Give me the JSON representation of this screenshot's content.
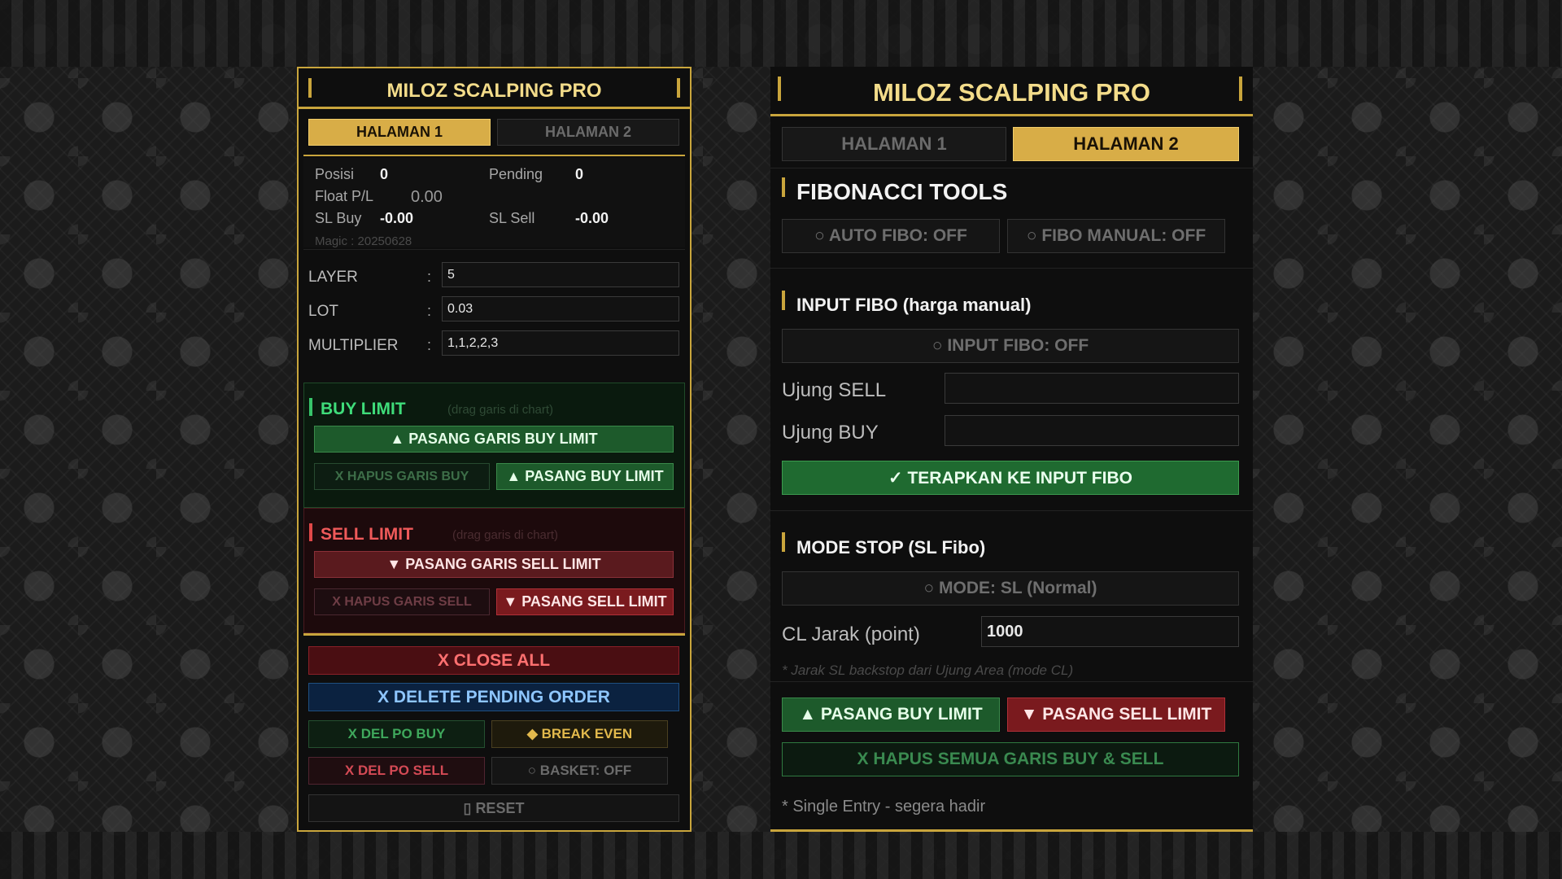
{
  "app_title": "MILOZ SCALPING PRO",
  "tabs": {
    "page1": "HALAMAN 1",
    "page2": "HALAMAN 2"
  },
  "page1": {
    "stats": {
      "posisi_label": "Posisi",
      "posisi_value": "0",
      "pending_label": "Pending",
      "pending_value": "0",
      "float_label": "Float P/L",
      "float_value": "0.00",
      "slbuy_label": "SL Buy",
      "slbuy_value": "-0.00",
      "slsell_label": "SL Sell",
      "slsell_value": "-0.00",
      "magic": "Magic : 20250628"
    },
    "params": [
      {
        "label": "LAYER",
        "value": "5"
      },
      {
        "label": "LOT",
        "value": "0.03"
      },
      {
        "label": "MULTIPLIER",
        "value": "1,1,2,2,3"
      }
    ],
    "colon": ":",
    "buy": {
      "title": "BUY LIMIT",
      "hint": "(drag garis di chart)",
      "place_line": "▲ PASANG GARIS BUY LIMIT",
      "delete_line": "X HAPUS GARIS BUY",
      "place": "▲ PASANG BUY LIMIT"
    },
    "sell": {
      "title": "SELL LIMIT",
      "hint": "(drag garis di chart)",
      "place_line": "▼ PASANG GARIS SELL LIMIT",
      "delete_line": "X HAPUS GARIS SELL",
      "place": "▼ PASANG SELL LIMIT"
    },
    "actions": {
      "close_all": "X CLOSE ALL",
      "delete_pending": "X DELETE PENDING ORDER",
      "del_po_buy": "X DEL PO BUY",
      "break_even": "◆ BREAK EVEN",
      "del_po_sell": "X DEL PO SELL",
      "basket": "○ BASKET: OFF",
      "reset": "▯ RESET"
    }
  },
  "page2": {
    "fib_title": "FIBONACCI TOOLS",
    "auto_fibo": "○ AUTO FIBO: OFF",
    "fibo_manual": "○ FIBO MANUAL: OFF",
    "input_title": "INPUT FIBO (harga manual)",
    "input_fibo": "○ INPUT FIBO: OFF",
    "ujung_sell": "Ujung SELL",
    "ujung_sell_value": "",
    "ujung_buy": "Ujung BUY",
    "ujung_buy_value": "",
    "apply": "✓ TERAPKAN KE INPUT FIBO",
    "mode_title": "MODE STOP (SL Fibo)",
    "mode": "○ MODE: SL (Normal)",
    "cl_label": "CL Jarak (point)",
    "cl_value": "1000",
    "cl_note": "* Jarak SL backstop dari Ujung Area (mode CL)",
    "place_buy": "▲ PASANG BUY LIMIT",
    "place_sell": "▼ PASANG SELL LIMIT",
    "delete_all": "X HAPUS SEMUA GARIS BUY & SELL",
    "note": "* Single Entry - segera hadir"
  },
  "colors": {
    "gold": "#c9a53c",
    "buy_green": "#2e7d32",
    "sell_red": "#8b1a1a",
    "blue": "#0d2a4a"
  }
}
